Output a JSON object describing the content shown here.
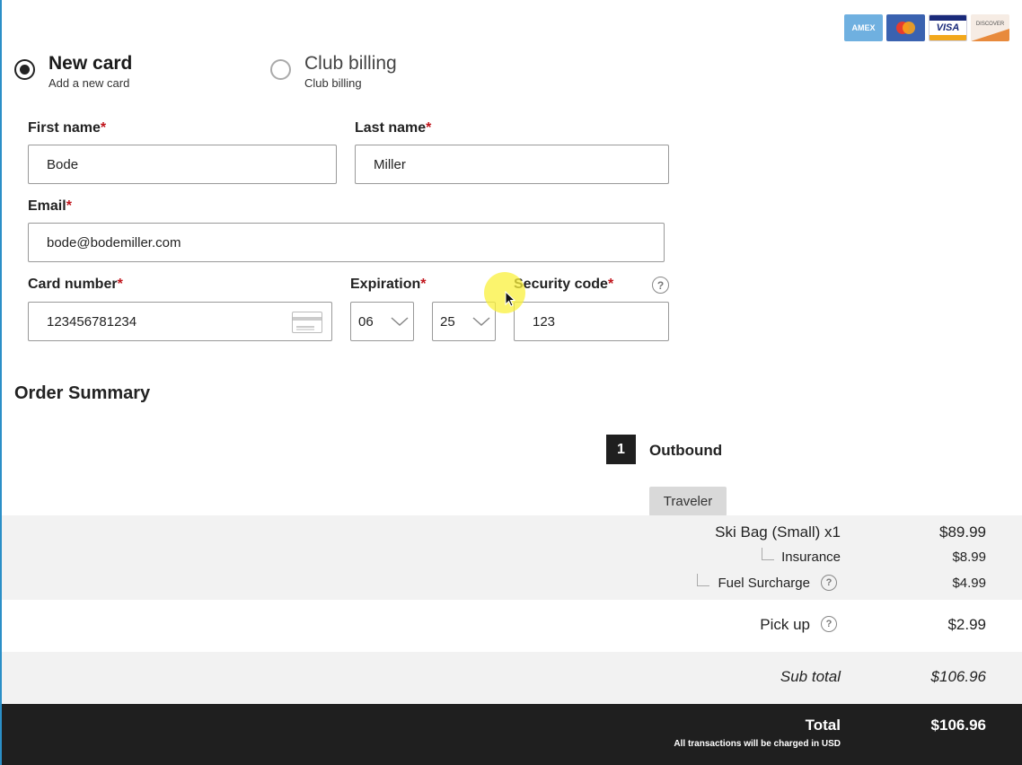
{
  "brands": {
    "amex": "AMEX",
    "visa": "VISA",
    "discover": "DISCOVER"
  },
  "payment_options": {
    "new_card": {
      "title": "New card",
      "subtitle": "Add a new card",
      "selected": true
    },
    "club_billing": {
      "title": "Club billing",
      "subtitle": "Club billing",
      "selected": false
    }
  },
  "form": {
    "first_name": {
      "label": "First name",
      "value": "Bode"
    },
    "last_name": {
      "label": "Last name",
      "value": "Miller"
    },
    "email": {
      "label": "Email",
      "value": "bode@bodemiller.com"
    },
    "card_number": {
      "label": "Card number",
      "value": "123456781234"
    },
    "expiration": {
      "label": "Expiration",
      "month": "06",
      "year": "25"
    },
    "security_code": {
      "label": "Security code",
      "value": "123"
    },
    "required_mark": "*",
    "help_glyph": "?"
  },
  "summary": {
    "title": "Order Summary",
    "leg_number": "1",
    "leg_label": "Outbound",
    "traveler_tag": "Traveler",
    "items": {
      "ski_bag": {
        "label": "Ski Bag (Small) x1",
        "amount": "$89.99"
      },
      "insurance": {
        "label": "Insurance",
        "amount": "$8.99"
      },
      "fuel": {
        "label": "Fuel Surcharge",
        "amount": "$4.99"
      },
      "pickup": {
        "label": "Pick up",
        "amount": "$2.99"
      }
    },
    "subtotal": {
      "label": "Sub total",
      "amount": "$106.96"
    },
    "total": {
      "label": "Total",
      "amount": "$106.96",
      "note": "All transactions will be charged in USD"
    }
  },
  "colors": {
    "required": "#c0141b",
    "total_band": "#1f1f1f",
    "gray_band": "#f2f2f2",
    "cursor_highlight": "#faf03c"
  }
}
